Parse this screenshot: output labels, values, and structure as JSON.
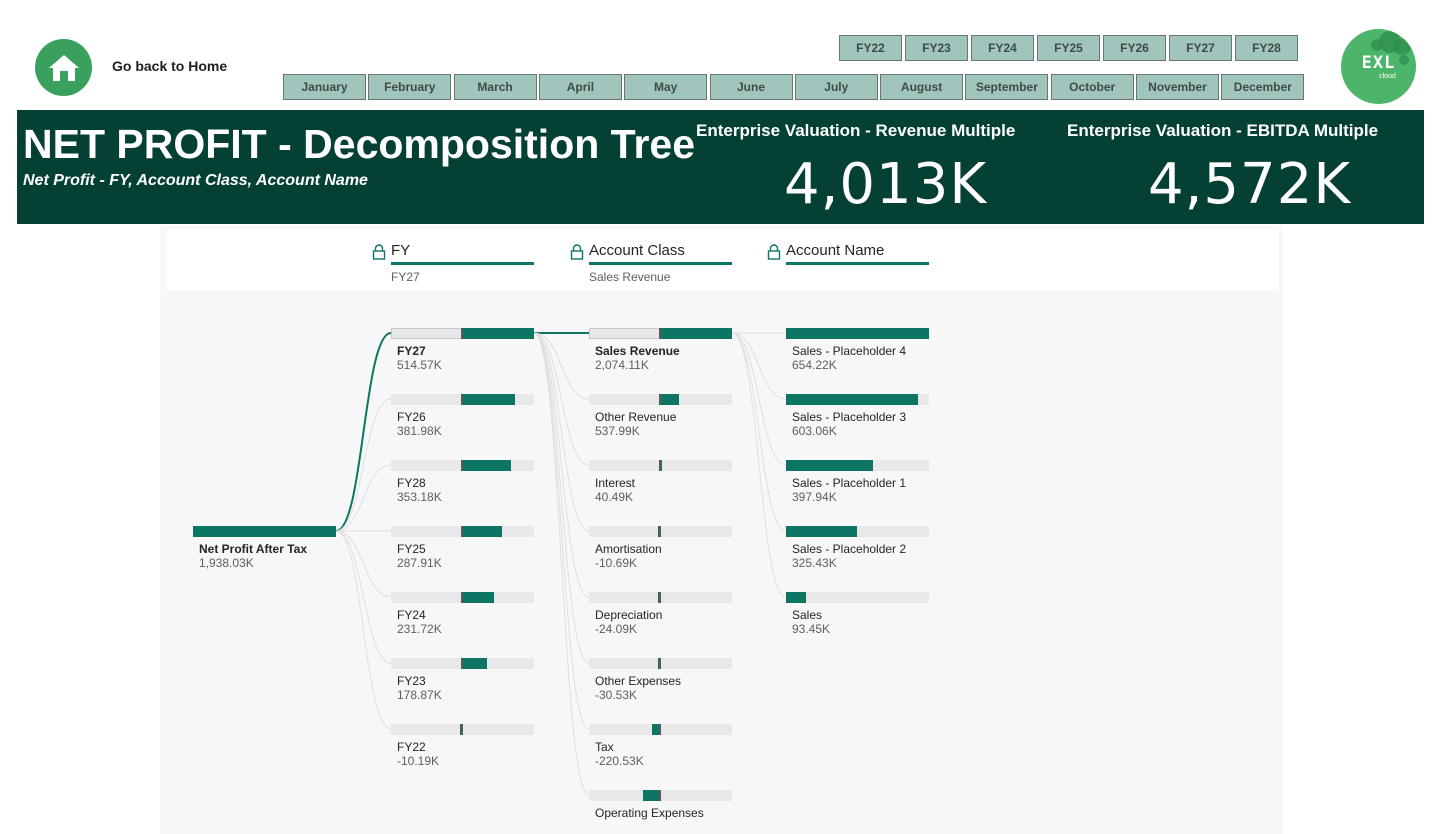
{
  "home": {
    "label": "Go back to Home"
  },
  "years": [
    "FY22",
    "FY23",
    "FY24",
    "FY25",
    "FY26",
    "FY27",
    "FY28"
  ],
  "months": [
    "January",
    "February",
    "March",
    "April",
    "May",
    "June",
    "July",
    "August",
    "September",
    "October",
    "November",
    "December"
  ],
  "logo": {
    "text": "EXL",
    "sub": "cloud"
  },
  "header": {
    "title": "NET PROFIT - Decomposition Tree",
    "subtitle": "Net Profit - FY, Account Class, Account Name",
    "kpis": [
      {
        "label": "Enterprise Valuation - Revenue Multiple",
        "value": "4,013K"
      },
      {
        "label": "Enterprise Valuation - EBITDA Multiple",
        "value": "4,572K"
      }
    ]
  },
  "tree": {
    "columns": [
      {
        "title": "FY",
        "selected": "FY27"
      },
      {
        "title": "Account Class",
        "selected": "Sales Revenue"
      },
      {
        "title": "Account Name",
        "selected": ""
      }
    ],
    "root": {
      "label": "Net Profit After Tax",
      "value": "1,938.03K",
      "amount": 1938.03
    },
    "levels": [
      [
        {
          "label": "FY27",
          "value": "514.57K",
          "amount": 514.57,
          "selected": true
        },
        {
          "label": "FY26",
          "value": "381.98K",
          "amount": 381.98
        },
        {
          "label": "FY28",
          "value": "353.18K",
          "amount": 353.18
        },
        {
          "label": "FY25",
          "value": "287.91K",
          "amount": 287.91
        },
        {
          "label": "FY24",
          "value": "231.72K",
          "amount": 231.72
        },
        {
          "label": "FY23",
          "value": "178.87K",
          "amount": 178.87
        },
        {
          "label": "FY22",
          "value": "-10.19K",
          "amount": -10.19
        }
      ],
      [
        {
          "label": "Sales Revenue",
          "value": "2,074.11K",
          "amount": 2074.11,
          "selected": true
        },
        {
          "label": "Other Revenue",
          "value": "537.99K",
          "amount": 537.99
        },
        {
          "label": "Interest",
          "value": "40.49K",
          "amount": 40.49
        },
        {
          "label": "Amortisation",
          "value": "-10.69K",
          "amount": -10.69
        },
        {
          "label": "Depreciation",
          "value": "-24.09K",
          "amount": -24.09
        },
        {
          "label": "Other Expenses",
          "value": "-30.53K",
          "amount": -30.53
        },
        {
          "label": "Tax",
          "value": "-220.53K",
          "amount": -220.53
        },
        {
          "label": "Operating Expenses",
          "value": "",
          "amount": -500
        }
      ],
      [
        {
          "label": "Sales - Placeholder 4",
          "value": "654.22K",
          "amount": 654.22
        },
        {
          "label": "Sales - Placeholder 3",
          "value": "603.06K",
          "amount": 603.06
        },
        {
          "label": "Sales - Placeholder 1",
          "value": "397.94K",
          "amount": 397.94
        },
        {
          "label": "Sales - Placeholder 2",
          "value": "325.43K",
          "amount": 325.43
        },
        {
          "label": "Sales",
          "value": "93.45K",
          "amount": 93.45
        }
      ]
    ]
  },
  "colors": {
    "accent": "#0c7564",
    "band": "#044134",
    "slicer": "#9fc5bd",
    "home": "#3aa05e",
    "logo": "#4cb56a"
  }
}
